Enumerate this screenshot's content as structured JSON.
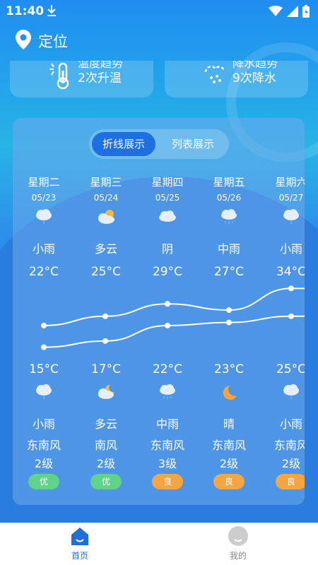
{
  "status_bar": {
    "time": "11:40"
  },
  "header": {
    "location_label": "定位"
  },
  "trend_cards": [
    {
      "title": "温度趋势",
      "value": "2次升温",
      "icon": "thermometer-sun-icon"
    },
    {
      "title": "降水趋势",
      "value": "9次降水",
      "icon": "rain-cloud-icon"
    }
  ],
  "toggle": {
    "chart_label": "折线展示",
    "list_label": "列表展示"
  },
  "forecast": [
    {
      "day": "星期二",
      "date": "05/23",
      "day_weather": "小雨",
      "high": "22°C",
      "low": "15°C",
      "night_weather": "小雨",
      "wind": "东南风",
      "level": "2级",
      "aqi": "优",
      "aqi_color": "#5fd38a",
      "day_icon": "light-rain-icon",
      "night_icon": "light-rain-icon"
    },
    {
      "day": "星期三",
      "date": "05/24",
      "day_weather": "多云",
      "high": "25°C",
      "low": "17°C",
      "night_weather": "多云",
      "wind": "南风",
      "level": "2级",
      "aqi": "优",
      "aqi_color": "#5fd38a",
      "day_icon": "partly-cloudy-sun-icon",
      "night_icon": "partly-cloudy-moon-icon"
    },
    {
      "day": "星期四",
      "date": "05/25",
      "day_weather": "阴",
      "high": "29°C",
      "low": "22°C",
      "night_weather": "中雨",
      "wind": "东南风",
      "level": "3级",
      "aqi": "良",
      "aqi_color": "#f5a541",
      "day_icon": "overcast-icon",
      "night_icon": "moderate-rain-icon"
    },
    {
      "day": "星期五",
      "date": "05/26",
      "day_weather": "中雨",
      "high": "27°C",
      "low": "23°C",
      "night_weather": "晴",
      "wind": "东南风",
      "level": "2级",
      "aqi": "良",
      "aqi_color": "#f5a541",
      "day_icon": "moderate-rain-icon",
      "night_icon": "clear-moon-icon"
    },
    {
      "day": "星期六",
      "date": "05/27",
      "day_weather": "小雨",
      "high": "34°C",
      "low": "25°C",
      "night_weather": "小雨",
      "wind": "东南风",
      "level": "2级",
      "aqi": "良",
      "aqi_color": "#f5a541",
      "day_icon": "light-rain-icon",
      "night_icon": "light-rain-icon"
    }
  ],
  "chart_data": {
    "type": "line",
    "categories": [
      "星期二",
      "星期三",
      "星期四",
      "星期五",
      "星期六"
    ],
    "series": [
      {
        "name": "",
        "values": [
          22,
          25,
          29,
          27,
          34
        ]
      },
      {
        "name": "",
        "values": [
          15,
          17,
          22,
          23,
          25
        ]
      }
    ]
  },
  "bottom_nav": {
    "home_label": "首页",
    "mine_label": "我的"
  },
  "colors": {
    "accent": "#1f6fd8",
    "aqi_good": "#5fd38a",
    "aqi_moderate": "#f5a541"
  }
}
